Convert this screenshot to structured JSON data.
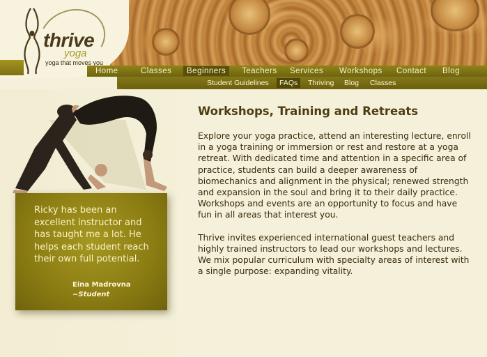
{
  "brand": {
    "name": "thrive",
    "sub": "yoga",
    "tagline": "yoga that moves you"
  },
  "nav": {
    "items": [
      "Home",
      "Classes",
      "Beginners",
      "Teachers",
      "Services",
      "Workshops",
      "Contact",
      "Blog"
    ],
    "active": "Beginners"
  },
  "subnav": {
    "items": [
      "Student Guidelines",
      "FAQs",
      "Thriving",
      "Blog",
      "Classes"
    ],
    "active": "FAQs"
  },
  "testimonial": {
    "quote": "Ricky has been an excellent instructor and has taught me a lot. He helps each student reach their own full potential.",
    "author": "Eina Madrovna",
    "role": "~Student"
  },
  "content": {
    "title": "Workshops, Training and Retreats",
    "paragraph1": "Explore your yoga practice, attend an interesting lecture, enroll in a yoga training or immersion or rest and restore at a yoga retreat. With dedicated time and attention in a specific area of practice, students can build a deeper awareness of biomechanics and alignment in the physical; renewed strength and expansion in the soul and bring it to their daily practice. Workshops and events are an opportunity to focus and have fun in all areas that interest you.",
    "paragraph2": "Thrive invites experienced international guest teachers and highly trained instructors to lead our workshops and lectures. We mix popular curriculum with specialty areas of interest with a single purpose: expanding vitality."
  },
  "colors": {
    "olive": "#8f8318",
    "olive_dark": "#6e6410",
    "background": "#f4f0d9",
    "heading": "#4e3d12"
  }
}
